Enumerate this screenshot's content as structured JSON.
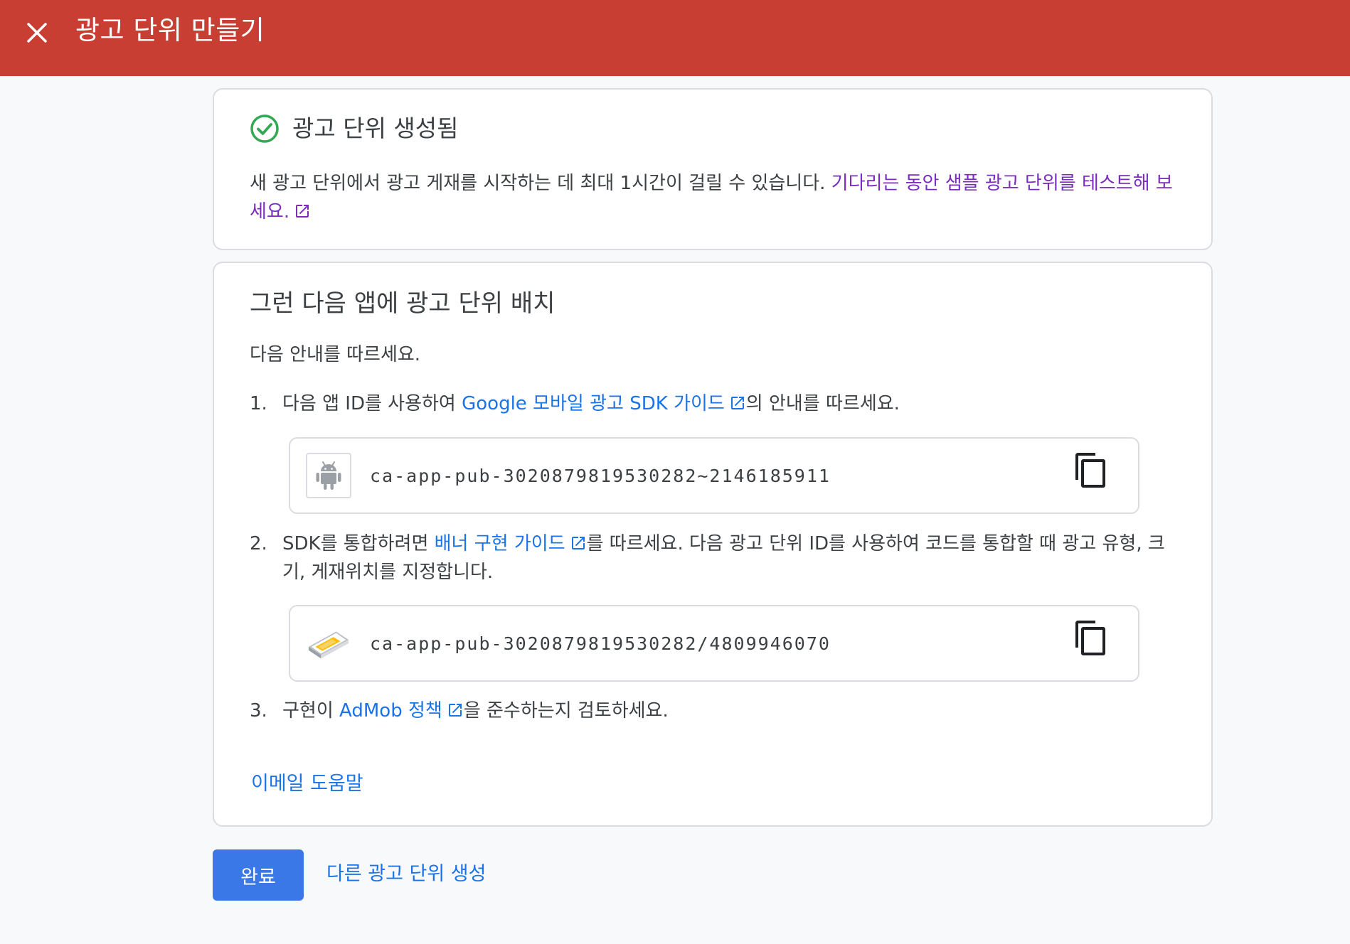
{
  "header": {
    "title": "광고 단위 만들기",
    "close_icon": "close-icon"
  },
  "success_card": {
    "title": "광고 단위 생성됨",
    "message": "새 광고 단위에서 광고 게재를 시작하는 데 최대 1시간이 걸릴 수 있습니다. ",
    "link_text": "기다리는 동안 샘플 광고 단위를 테스트해 보세요.",
    "accent_color": "#34a853"
  },
  "setup_card": {
    "title": "그런 다음 앱에 광고 단위 배치",
    "intro": "다음 안내를 따르세요.",
    "steps": [
      {
        "num": "1.",
        "before": "다음 앱 ID를 사용하여 ",
        "link": "Google 모바일 광고 SDK 가이드",
        "after": "의 안내를 따르세요."
      },
      {
        "num": "2.",
        "before": "SDK를 통합하려면 ",
        "link": "배너 구현 가이드",
        "after": "를 따르세요. 다음 광고 단위 ID를 사용하여 코드를 통합할 때 광고 유형, 크기, 게재위치를 지정합니다."
      },
      {
        "num": "3.",
        "before": "구현이 ",
        "link": "AdMob 정책",
        "after": "을 준수하는지 검토하세요."
      }
    ],
    "app_id": "ca-app-pub-3020879819530282~2146185911",
    "ad_unit_id": "ca-app-pub-3020879819530282/4809946070",
    "email_help": "이메일 도움말"
  },
  "actions": {
    "done_label": "완료",
    "create_another_label": "다른 광고 단위 생성"
  },
  "colors": {
    "header_bg": "#c83e32",
    "link_blue": "#1a73e8",
    "link_purple": "#7b2cbf",
    "primary_button": "#3b78e7"
  }
}
